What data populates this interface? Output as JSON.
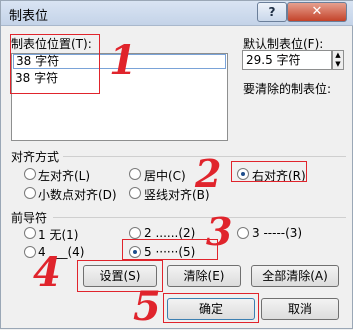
{
  "window": {
    "title": "制表位",
    "help_glyph": "?",
    "close_glyph": "✕"
  },
  "tab_position": {
    "label": "制表位位置(T):",
    "value": "38 字符",
    "items": [
      "38 字符"
    ]
  },
  "default_tab": {
    "label": "默认制表位(F):",
    "value": "29.5 字符"
  },
  "tabs_to_clear": {
    "label": "要清除的制表位:"
  },
  "alignment": {
    "label": "对齐方式",
    "options": [
      {
        "label": "左对齐(L)",
        "selected": false
      },
      {
        "label": "居中(C)",
        "selected": false
      },
      {
        "label": "右对齐(R)",
        "selected": true
      },
      {
        "label": "小数点对齐(D)",
        "selected": false
      },
      {
        "label": "竖线对齐(B)",
        "selected": false
      }
    ]
  },
  "leader": {
    "label": "前导符",
    "options": [
      {
        "label": "1 无(1)",
        "selected": false
      },
      {
        "label": "2 ......(2)",
        "selected": false
      },
      {
        "label": "3 -----(3)",
        "selected": false
      },
      {
        "label": "4 ___(4)",
        "selected": false
      },
      {
        "label": "5 ······(5)",
        "selected": true
      }
    ]
  },
  "buttons": {
    "set": "设置(S)",
    "clear": "清除(E)",
    "clear_all": "全部清除(A)",
    "ok": "确定",
    "cancel": "取消"
  },
  "annotations": [
    "1",
    "2",
    "3",
    "4",
    "5"
  ],
  "annotation_color": "#e0242c"
}
